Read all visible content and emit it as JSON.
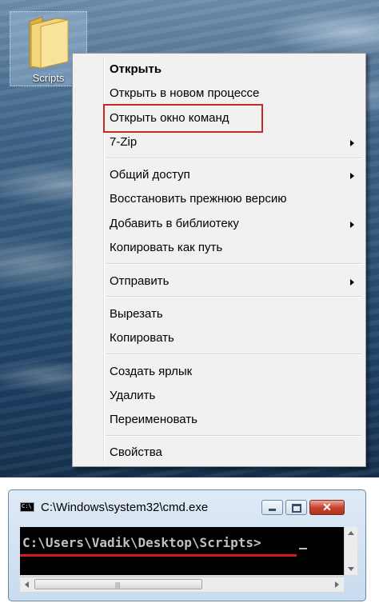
{
  "desktop": {
    "folder": {
      "label": "Scripts",
      "icon": "folder-icon"
    }
  },
  "context_menu": {
    "items": [
      {
        "label": "Открыть",
        "bold": true
      },
      {
        "label": "Открыть в новом процессе"
      },
      {
        "label": "Открыть окно команд",
        "highlighted": true
      },
      {
        "label": "7-Zip",
        "submenu": true
      },
      {
        "label": "Общий доступ",
        "submenu": true
      },
      {
        "label": "Восстановить прежнюю версию"
      },
      {
        "label": "Добавить в библиотеку",
        "submenu": true
      },
      {
        "label": "Копировать как путь"
      },
      {
        "label": "Отправить",
        "submenu": true
      },
      {
        "label": "Вырезать"
      },
      {
        "label": "Копировать"
      },
      {
        "label": "Создать ярлык"
      },
      {
        "label": "Удалить"
      },
      {
        "label": "Переименовать"
      },
      {
        "label": "Свойства"
      }
    ],
    "highlight_color": "#c62828"
  },
  "cmd_window": {
    "title": "C:\\Windows\\system32\\cmd.exe",
    "prompt": "C:\\Users\\Vadik\\Desktop\\Scripts>",
    "close_label": "✕",
    "underline_color": "#d61b1b"
  }
}
